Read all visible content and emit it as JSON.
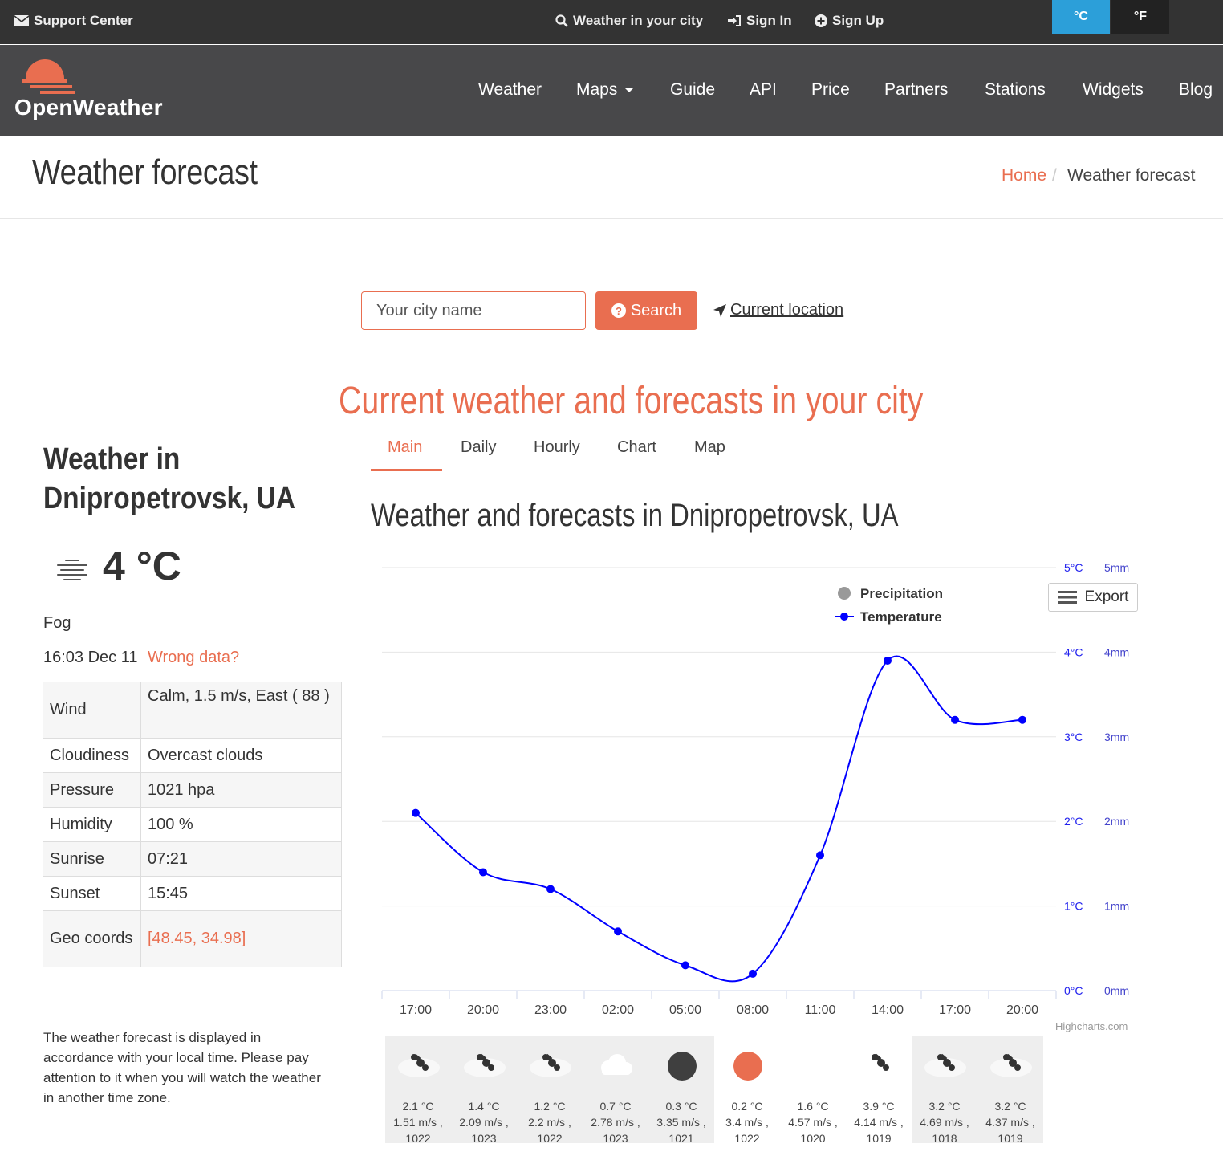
{
  "topbar": {
    "support": "Support Center",
    "weather_city": "Weather in your city",
    "sign_in": "Sign In",
    "sign_up": "Sign Up",
    "unit_c": "°C",
    "unit_f": "°F"
  },
  "logo": {
    "text": "OpenWeather"
  },
  "nav": {
    "weather": "Weather",
    "maps": "Maps",
    "guide": "Guide",
    "api": "API",
    "price": "Price",
    "partners": "Partners",
    "stations": "Stations",
    "widgets": "Widgets",
    "blog": "Blog"
  },
  "page": {
    "title": "Weather forecast",
    "breadcrumb_home": "Home",
    "breadcrumb_sep": "/",
    "breadcrumb_current": "Weather forecast"
  },
  "search": {
    "placeholder": "Your city name",
    "button": "Search",
    "current_location": "Current location"
  },
  "headline": "Current weather and forecasts in your city",
  "tabs": {
    "main": "Main",
    "daily": "Daily",
    "hourly": "Hourly",
    "chart": "Chart",
    "map": "Map"
  },
  "sidebar": {
    "title_line1": "Weather in",
    "title_line2": "Dnipropetrovsk, UA",
    "temp": "4 °C",
    "description": "Fog",
    "time": "16:03 Dec 11",
    "wrong_data": "Wrong data?",
    "rows": [
      {
        "label": "Wind",
        "value": "Calm, 1.5 m/s, East ( 88 )"
      },
      {
        "label": "Cloudiness",
        "value": "Overcast clouds"
      },
      {
        "label": "Pressure",
        "value": "1021 hpa"
      },
      {
        "label": "Humidity",
        "value": "100 %"
      },
      {
        "label": "Sunrise",
        "value": "07:21"
      },
      {
        "label": "Sunset",
        "value": "15:45"
      },
      {
        "label": "Geo coords",
        "value": "[48.45, 34.98]"
      }
    ],
    "note": "The weather forecast is displayed in accordance with your local time. Please pay attention to it when you will watch the weather in another time zone."
  },
  "forecast_title": "Weather and forecasts in Dnipropetrovsk, UA",
  "export_label": "Export",
  "highcharts_credit": "Highcharts.com",
  "chart_data": {
    "type": "line",
    "categories": [
      "17:00",
      "20:00",
      "23:00",
      "02:00",
      "05:00",
      "08:00",
      "11:00",
      "14:00",
      "17:00",
      "20:00"
    ],
    "series": [
      {
        "name": "Temperature",
        "values": [
          2.1,
          1.4,
          1.2,
          0.7,
          0.3,
          0.2,
          1.6,
          3.9,
          3.2,
          3.2
        ],
        "color": "#0000ff"
      },
      {
        "name": "Precipitation",
        "values": [
          0,
          0,
          0,
          0,
          0,
          0,
          0,
          0,
          0,
          0
        ],
        "color": "#999999"
      }
    ],
    "y_temp_ticks": [
      "0°C",
      "1°C",
      "2°C",
      "3°C",
      "4°C",
      "5°C"
    ],
    "y_precip_ticks": [
      "0mm",
      "1mm",
      "2mm",
      "3mm",
      "4mm",
      "5mm"
    ],
    "ylim": [
      0,
      5
    ],
    "legend_position": "top-right",
    "grid": true
  },
  "strip": [
    {
      "icon": "snow",
      "temp": "2.1 °C",
      "wind": "1.51 m/s ,",
      "pressure": "1022",
      "shaded": true
    },
    {
      "icon": "snow",
      "temp": "1.4 °C",
      "wind": "2.09 m/s ,",
      "pressure": "1023",
      "shaded": true
    },
    {
      "icon": "snow",
      "temp": "1.2 °C",
      "wind": "2.2 m/s ,",
      "pressure": "1022",
      "shaded": true
    },
    {
      "icon": "cloud",
      "temp": "0.7 °C",
      "wind": "2.78 m/s ,",
      "pressure": "1023",
      "shaded": true
    },
    {
      "icon": "dark",
      "temp": "0.3 °C",
      "wind": "3.35 m/s ,",
      "pressure": "1021",
      "shaded": true
    },
    {
      "icon": "sun",
      "temp": "0.2 °C",
      "wind": "3.4 m/s ,",
      "pressure": "1022",
      "shaded": false
    },
    {
      "icon": "cloud",
      "temp": "1.6 °C",
      "wind": "4.57 m/s ,",
      "pressure": "1020",
      "shaded": false
    },
    {
      "icon": "snow",
      "temp": "3.9 °C",
      "wind": "4.14 m/s ,",
      "pressure": "1019",
      "shaded": false
    },
    {
      "icon": "snow",
      "temp": "3.2 °C",
      "wind": "4.69 m/s ,",
      "pressure": "1018",
      "shaded": true
    },
    {
      "icon": "snow",
      "temp": "3.2 °C",
      "wind": "4.37 m/s ,",
      "pressure": "1019",
      "shaded": true
    }
  ],
  "colors": {
    "accent": "#e96e50",
    "topbar": "#333333",
    "navbar": "#48484a",
    "unit_active": "#2c9fd9"
  }
}
